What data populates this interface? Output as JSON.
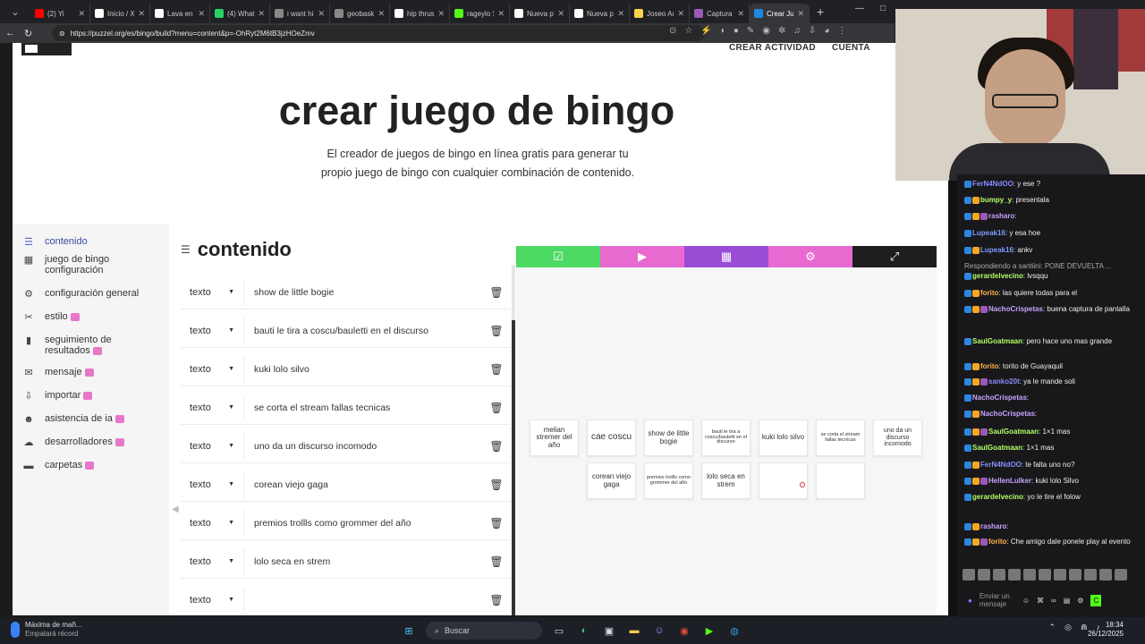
{
  "browser": {
    "tabs": [
      {
        "label": "(2) Yi",
        "color": "#ff0000"
      },
      {
        "label": "Inicio / X",
        "color": "#ffffff"
      },
      {
        "label": "Lava en",
        "color": "#ffffff"
      },
      {
        "label": "(4) What",
        "color": "#25d366"
      },
      {
        "label": "i want hi",
        "color": "#888888"
      },
      {
        "label": "geobask",
        "color": "#888888"
      },
      {
        "label": "hip thrust",
        "color": "#ffffff"
      },
      {
        "label": "rageylo S",
        "color": "#53fc18"
      },
      {
        "label": "Nueva pe",
        "color": "#ffffff"
      },
      {
        "label": "Nueva pe",
        "color": "#ffffff"
      },
      {
        "label": "Joseo Au",
        "color": "#f9d649"
      },
      {
        "label": "Captura d",
        "color": "#9b59b6"
      },
      {
        "label": "Crear Jue",
        "color": "#1e88e5",
        "active": true
      }
    ],
    "new_tab": "+",
    "url": "https://puzzel.org/es/bingo/build?menu=content&p=-OhRyt2M6tB3jzHOeZmv"
  },
  "page": {
    "nav": {
      "create_activity": "CREAR ACTIVIDAD",
      "account": "CUENTA"
    },
    "title": "crear juego de bingo",
    "subtitle": "El creador de juegos de bingo en línea gratis para generar tu propio juego de bingo con cualquier combinación de contenido."
  },
  "sidebar": {
    "items": [
      {
        "label": "contenido",
        "icon": "list-icon",
        "glyph": "☰",
        "active": true,
        "new": false
      },
      {
        "label": "juego de bingo configuración",
        "icon": "grid-settings-icon",
        "glyph": "▦",
        "new": false
      },
      {
        "label": "configuración general",
        "icon": "settings-icon",
        "glyph": "⚙",
        "new": false
      },
      {
        "label": "estilo",
        "icon": "brush-icon",
        "glyph": "✂",
        "new": true
      },
      {
        "label": "seguimiento de resultados",
        "icon": "chart-icon",
        "glyph": "▮",
        "new": true
      },
      {
        "label": "mensaje",
        "icon": "message-icon",
        "glyph": "✉",
        "new": true
      },
      {
        "label": "importar",
        "icon": "import-icon",
        "glyph": "⇩",
        "new": true
      },
      {
        "label": "asistencia de ia",
        "icon": "ai-icon",
        "glyph": "☻",
        "new": true
      },
      {
        "label": "desarrolladores",
        "icon": "cloud-icon",
        "glyph": "☁",
        "new": true
      },
      {
        "label": "carpetas",
        "icon": "folder-icon",
        "glyph": "▬",
        "new": true
      }
    ]
  },
  "content": {
    "heading": "contenido",
    "type_label": "texto",
    "rows": [
      "show de little bogie",
      "bauti le tira a coscu/bauletti en el discurso",
      "kuki lolo silvo",
      "se corta el stream fallas tecnicas",
      "uno da un discurso incomodo",
      "corean viejo gaga",
      "premios trollls como grommer del año",
      "lolo seca en strem",
      ""
    ]
  },
  "preview": {
    "toolbar_colors": [
      "#4cd964",
      "#e86ad0",
      "#9b4dd6",
      "#e86ad0",
      "#1e1e1e"
    ],
    "toolbar_icons": [
      "clipboard-icon",
      "play-icon",
      "grid-icon",
      "settings-icon",
      "expand-icon"
    ],
    "toolbar_glyphs": [
      "☑",
      "▶",
      "▦",
      "⚙",
      "⤢"
    ],
    "cells_row1": [
      "melian stremer del año",
      "cae coscu",
      "show de little bogie",
      "bauti le tira a coscu/bauletti en el discurso",
      "kuki lolo silvo",
      "se corta el stream fallas tecnicas",
      "uno da un discurso incomodo"
    ],
    "cells_row2": [
      "corean viejo gaga",
      "premios trollls como grommer del año",
      "lolo seca en strem",
      "",
      ""
    ]
  },
  "chat": {
    "messages": [
      {
        "user": "FerN4NdOO",
        "text": ": y ese ?",
        "color": "#8a8aff"
      },
      {
        "user": "bumpy_y",
        "text": ": presentala",
        "color": "#b3ff66"
      },
      {
        "user": "rasharo",
        "text": ":",
        "color": "#c8a2ff"
      },
      {
        "user": "Lupeak16",
        "text": ": y esa hoe",
        "color": "#7a9cff"
      },
      {
        "user": "Lupeak16",
        "text": ": ankv",
        "color": "#7a9cff"
      },
      {
        "user": "",
        "text": "Respondiendo a santiini: PONE DEVUELTA ...",
        "color": "#aaaaaa"
      },
      {
        "user": "gerardelvecino",
        "text": ": lvsqqu",
        "color": "#b3ff66"
      },
      {
        "user": "forito",
        "text": ": las quiere todas para el",
        "color": "#ffb347"
      },
      {
        "user": "NachoCrispetas",
        "text": ": buena captura de pantalla",
        "color": "#c8a2ff"
      },
      {
        "user": "SaulGoatmaan",
        "text": ": pero hace uno mas grande",
        "color": "#b3ff66"
      },
      {
        "user": "forito",
        "text": ": torito de Guayaquil",
        "color": "#ffb347"
      },
      {
        "user": "sanko20t",
        "text": ": ya le mande soli",
        "color": "#8a8aff"
      },
      {
        "user": "NachoCrispetas",
        "text": ":",
        "color": "#c8a2ff"
      },
      {
        "user": "NachoCrispetas",
        "text": ":",
        "color": "#c8a2ff"
      },
      {
        "user": "SaulGoatmaan",
        "text": ": 1×1 mas",
        "color": "#b3ff66"
      },
      {
        "user": "SaulGoatmaan",
        "text": ": 1×1 mas",
        "color": "#b3ff66"
      },
      {
        "user": "FerN4NdOO",
        "text": ": te falta uno no?",
        "color": "#8a8aff"
      },
      {
        "user": "HellenLulker",
        "text": ": kuki lolo Silvo",
        "color": "#c8a2ff"
      },
      {
        "user": "gerardelvecino",
        "text": ": yo le tire el folow",
        "color": "#b3ff66"
      },
      {
        "user": "rasharo",
        "text": ":",
        "color": "#c8a2ff"
      },
      {
        "user": "forito",
        "text": ": Che amigo dale ponele play al evento",
        "color": "#ffb347"
      }
    ],
    "send_label": "Enviar un mensaje"
  },
  "taskbar": {
    "weather_title": "Máxima de mañ...",
    "weather_sub": "Empatará récord",
    "search": "Buscar",
    "time": "18:34",
    "date": "26/12/2025"
  }
}
